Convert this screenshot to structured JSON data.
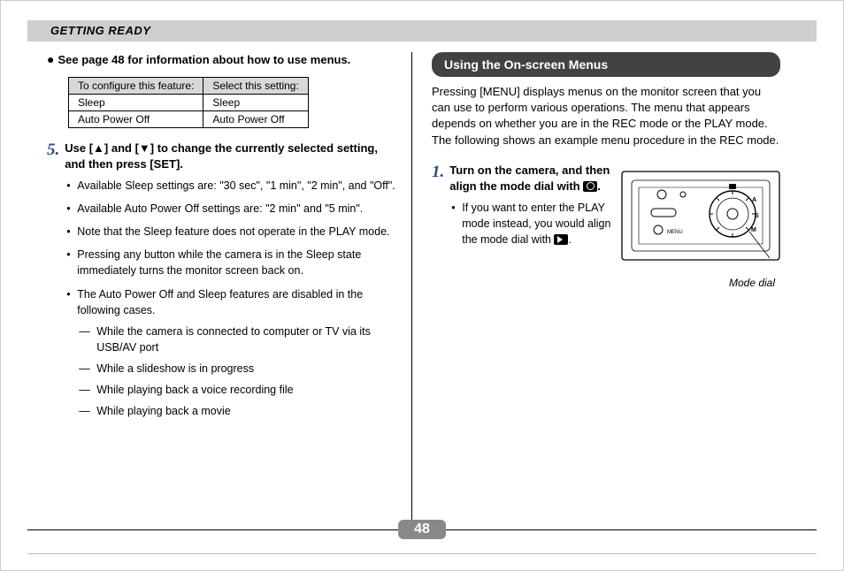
{
  "header": {
    "section_title": "GETTING READY"
  },
  "left": {
    "see_note": "See page 48 for information about how to use menus.",
    "table": {
      "headers": [
        "To configure this feature:",
        "Select this setting:"
      ],
      "rows": [
        {
          "feature": "Sleep",
          "setting": "Sleep"
        },
        {
          "feature": "Auto Power Off",
          "setting": "Auto Power Off"
        }
      ]
    },
    "step5": {
      "number": "5.",
      "title": "Use [▲] and [▼] to change the currently selected setting, and then press [SET].",
      "bullets": [
        "Available Sleep settings are: \"30 sec\", \"1 min\", \"2 min\", and \"Off\".",
        "Available Auto Power Off settings are: \"2 min\" and \"5 min\".",
        "Note that the Sleep feature does not operate in the PLAY mode.",
        "Pressing any button while the camera is in the Sleep state immediately turns the monitor screen back on.",
        "The Auto Power Off and Sleep features are disabled in the following cases."
      ],
      "dashes": [
        "While the camera is connected to computer or TV via its USB/AV port",
        "While a slideshow is in progress",
        "While playing back a voice recording file",
        "While playing back a movie"
      ]
    }
  },
  "right": {
    "section_heading": "Using the On-screen Menus",
    "lead": "Pressing [MENU] displays menus on the monitor screen that you can use to perform various operations. The menu that appears depends on whether you are in the REC mode or the PLAY mode. The following shows an example menu procedure in the REC mode.",
    "step1": {
      "number": "1.",
      "title_pre": "Turn on the camera, and then align the mode dial with ",
      "title_post": ".",
      "bullet_pre": "If you want to enter the PLAY mode instead, you would align the mode dial with ",
      "bullet_post": "."
    },
    "illustration_caption": "Mode dial",
    "menu_label": "MENU"
  },
  "footer": {
    "page_number": "48"
  }
}
